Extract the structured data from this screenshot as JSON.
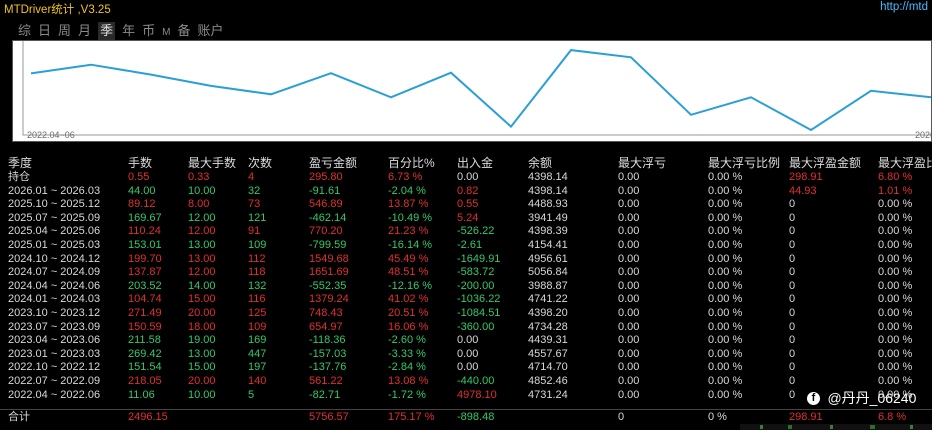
{
  "app": {
    "title": "MTDriver统计 ,V3.25",
    "url": "http://mtd"
  },
  "tabs": [
    {
      "label": "综",
      "active": false
    },
    {
      "label": "日",
      "active": false
    },
    {
      "label": "周",
      "active": false
    },
    {
      "label": "月",
      "active": false
    },
    {
      "label": "季",
      "active": true
    },
    {
      "label": "年",
      "active": false
    },
    {
      "label": "币",
      "active": false
    },
    {
      "label": "M",
      "active": false
    },
    {
      "label": "备",
      "active": false
    },
    {
      "label": "账户",
      "active": false
    }
  ],
  "chart": {
    "x_start_label": "2022.04~06",
    "x_end_label": "2026",
    "line_color": "#2a9fd6",
    "axis_color": "#9a9a9a",
    "series": [
      4731.24,
      4852.46,
      4714.7,
      4557.67,
      4439.31,
      4734.28,
      4398.2,
      4741.22,
      3988.87,
      5056.84,
      4956.61,
      4154.41,
      4398.39,
      3941.49,
      4488.93,
      4398.14
    ],
    "y_range": [
      3900,
      5100
    ]
  },
  "table": {
    "headers": [
      "季度",
      "手数",
      "最大手数",
      "次数",
      "盈亏金额",
      "百分比%",
      "出入金",
      "余额",
      "最大浮亏",
      "最大浮亏比例",
      "最大浮盈金额",
      "最大浮盈比"
    ],
    "rows": [
      [
        "持仓",
        "0.55",
        "0.33",
        "4",
        "295.80",
        "6.73 %",
        "0.00",
        "4398.14",
        "0.00",
        "0.00 %",
        "298.91",
        "6.80 %"
      ],
      [
        "2026.01 ~ 2026.03",
        "44.00",
        "10.00",
        "32",
        "-91.61",
        "-2.04 %",
        "0.82",
        "4398.14",
        "0.00",
        "0.00 %",
        "44.93",
        "1.01 %"
      ],
      [
        "2025.10 ~ 2025.12",
        "89.12",
        "8.00",
        "73",
        "546.89",
        "13.87 %",
        "0.55",
        "4488.93",
        "0.00",
        "0.00 %",
        "0",
        "0.00 %"
      ],
      [
        "2025.07 ~ 2025.09",
        "169.67",
        "12.00",
        "121",
        "-462.14",
        "-10.49 %",
        "5.24",
        "3941.49",
        "0.00",
        "0.00 %",
        "0",
        "0.00 %"
      ],
      [
        "2025.04 ~ 2025.06",
        "110.24",
        "12.00",
        "91",
        "770.20",
        "21.23 %",
        "-526.22",
        "4398.39",
        "0.00",
        "0.00 %",
        "0",
        "0.00 %"
      ],
      [
        "2025.01 ~ 2025.03",
        "153.01",
        "13.00",
        "109",
        "-799.59",
        "-16.14 %",
        "-2.61",
        "4154.41",
        "0.00",
        "0.00 %",
        "0",
        "0.00 %"
      ],
      [
        "2024.10 ~ 2024.12",
        "199.70",
        "13.00",
        "112",
        "1549.68",
        "45.49 %",
        "-1649.91",
        "4956.61",
        "0.00",
        "0.00 %",
        "0",
        "0.00 %"
      ],
      [
        "2024.07 ~ 2024.09",
        "137.87",
        "12.00",
        "118",
        "1651.69",
        "48.51 %",
        "-583.72",
        "5056.84",
        "0.00",
        "0.00 %",
        "0",
        "0.00 %"
      ],
      [
        "2024.04 ~ 2024.06",
        "203.52",
        "14.00",
        "132",
        "-552.35",
        "-12.16 %",
        "-200.00",
        "3988.87",
        "0.00",
        "0.00 %",
        "0",
        "0.00 %"
      ],
      [
        "2024.01 ~ 2024.03",
        "104.74",
        "15.00",
        "116",
        "1379.24",
        "41.02 %",
        "-1036.22",
        "4741.22",
        "0.00",
        "0.00 %",
        "0",
        "0.00 %"
      ],
      [
        "2023.10 ~ 2023.12",
        "271.49",
        "20.00",
        "125",
        "748.43",
        "20.51 %",
        "-1084.51",
        "4398.20",
        "0.00",
        "0.00 %",
        "0",
        "0.00 %"
      ],
      [
        "2023.07 ~ 2023.09",
        "150.59",
        "18.00",
        "109",
        "654.97",
        "16.06 %",
        "-360.00",
        "4734.28",
        "0.00",
        "0.00 %",
        "0",
        "0.00 %"
      ],
      [
        "2023.04 ~ 2023.06",
        "211.58",
        "19.00",
        "169",
        "-118.36",
        "-2.60 %",
        "0.00",
        "4439.31",
        "0.00",
        "0.00 %",
        "0",
        "0.00 %"
      ],
      [
        "2023.01 ~ 2023.03",
        "269.42",
        "13.00",
        "447",
        "-157.03",
        "-3.33 %",
        "0.00",
        "4557.67",
        "0.00",
        "0.00 %",
        "0",
        "0.00 %"
      ],
      [
        "2022.10 ~ 2022.12",
        "151.54",
        "15.00",
        "197",
        "-137.76",
        "-2.84 %",
        "0.00",
        "4714.70",
        "0.00",
        "0.00 %",
        "0",
        "0.00 %"
      ],
      [
        "2022.07 ~ 2022.09",
        "218.05",
        "20.00",
        "140",
        "561.22",
        "13.08 %",
        "-440.00",
        "4852.46",
        "0.00",
        "0.00 %",
        "0",
        "0.00 %"
      ],
      [
        "2022.04 ~ 2022.06",
        "11.06",
        "10.00",
        "5",
        "-82.71",
        "-1.72 %",
        "4978.10",
        "4731.24",
        "0.00",
        "0.00 %",
        "0",
        "0.00 %"
      ]
    ],
    "total": [
      "合计",
      "2496.15",
      "",
      "",
      "5756.57",
      "175.17 %",
      "-898.48",
      "",
      "0",
      "0 %",
      "298.91",
      "6.8 %"
    ]
  },
  "colors": {
    "positive": "#e03030",
    "negative": "#34c96a",
    "neutral": "#d8d8d8",
    "header": "#dcdcdc",
    "title": "#f0c419",
    "link": "#4db8ff"
  },
  "watermark": {
    "icon": "facebook-icon",
    "text": "@丹丹_06240"
  }
}
